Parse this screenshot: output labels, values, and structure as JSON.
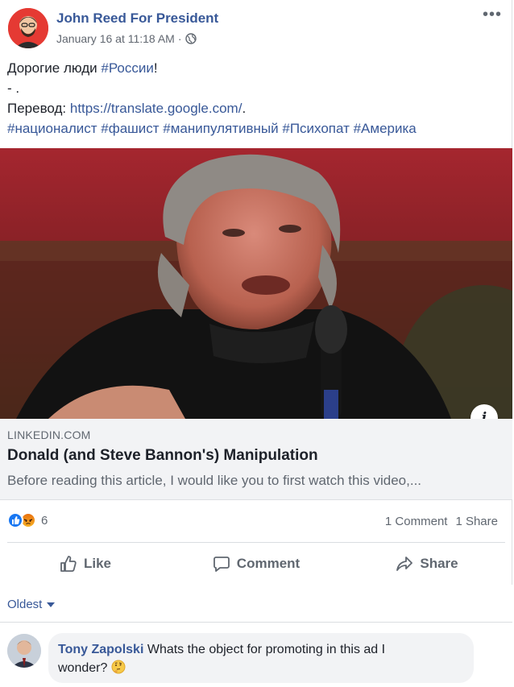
{
  "post": {
    "author": "John Reed For President",
    "timestamp": "January 16 at 11:18 AM",
    "separator": "·",
    "privacy_icon": "globe-icon",
    "more_label": "•••",
    "line1_text": "Дорогие люди ",
    "line1_hashtag": "#России",
    "line1_end": "!",
    "line2": "- .",
    "line3_label": "Перевод: ",
    "line3_link": "https://translate.google.com/",
    "line3_end": ".",
    "hashtags": "#националист #фашист #манипулятивный #Психопат #Америка"
  },
  "preview": {
    "domain": "LINKEDIN.COM",
    "title": "Donald (and Steve Bannon's) Manipulation",
    "description": "Before reading this article, I would like you to first watch this video,...",
    "info_label": "i"
  },
  "reactions": {
    "icons": [
      "like-icon",
      "angry-icon"
    ],
    "count": "6",
    "comments": "1 Comment",
    "shares": "1 Share"
  },
  "actions": {
    "like": "Like",
    "comment": "Comment",
    "share": "Share"
  },
  "comments_section": {
    "sort_label": "Oldest",
    "items": [
      {
        "name": "Tony Zapolski",
        "text_line1": " Whats the object for promoting in this ad I",
        "text_line2": "wonder? "
      }
    ]
  },
  "colors": {
    "link_blue": "#385898",
    "brand_blue": "#1877f2",
    "muted": "#606770",
    "preview_bg": "#f2f3f5"
  }
}
